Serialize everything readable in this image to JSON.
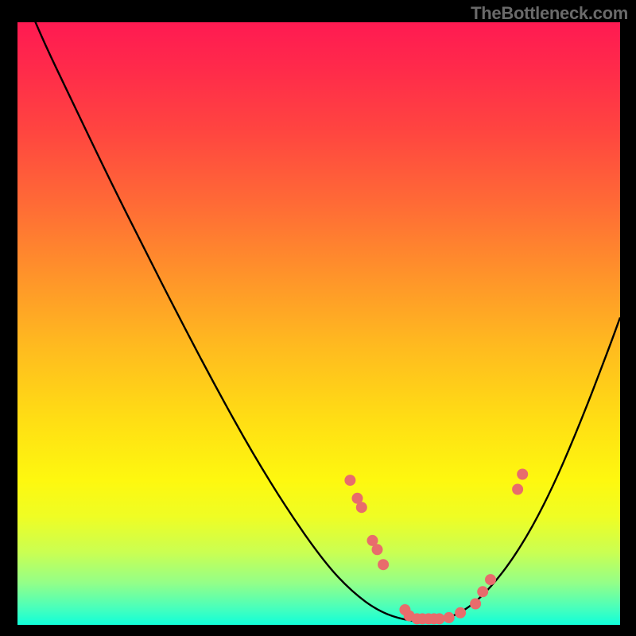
{
  "watermark": "TheBottleneck.com",
  "chart_data": {
    "type": "line",
    "title": "",
    "xlabel": "",
    "ylabel": "",
    "xlim": [
      0,
      1
    ],
    "ylim": [
      0,
      1
    ],
    "curve": [
      {
        "x": 0.005,
        "y": 1.06
      },
      {
        "x": 0.04,
        "y": 0.975
      },
      {
        "x": 0.09,
        "y": 0.87
      },
      {
        "x": 0.15,
        "y": 0.745
      },
      {
        "x": 0.21,
        "y": 0.625
      },
      {
        "x": 0.27,
        "y": 0.507
      },
      {
        "x": 0.33,
        "y": 0.393
      },
      {
        "x": 0.39,
        "y": 0.285
      },
      {
        "x": 0.45,
        "y": 0.188
      },
      {
        "x": 0.51,
        "y": 0.103
      },
      {
        "x": 0.555,
        "y": 0.055
      },
      {
        "x": 0.6,
        "y": 0.022
      },
      {
        "x": 0.645,
        "y": 0.007
      },
      {
        "x": 0.69,
        "y": 0.005
      },
      {
        "x": 0.735,
        "y": 0.018
      },
      {
        "x": 0.78,
        "y": 0.055
      },
      {
        "x": 0.83,
        "y": 0.12
      },
      {
        "x": 0.88,
        "y": 0.21
      },
      {
        "x": 0.93,
        "y": 0.325
      },
      {
        "x": 0.98,
        "y": 0.455
      },
      {
        "x": 1.0,
        "y": 0.51
      }
    ],
    "points": [
      {
        "x": 0.552,
        "y": 0.24
      },
      {
        "x": 0.564,
        "y": 0.21
      },
      {
        "x": 0.571,
        "y": 0.195
      },
      {
        "x": 0.589,
        "y": 0.14
      },
      {
        "x": 0.597,
        "y": 0.125
      },
      {
        "x": 0.607,
        "y": 0.1
      },
      {
        "x": 0.643,
        "y": 0.025
      },
      {
        "x": 0.65,
        "y": 0.015
      },
      {
        "x": 0.663,
        "y": 0.01
      },
      {
        "x": 0.672,
        "y": 0.01
      },
      {
        "x": 0.682,
        "y": 0.01
      },
      {
        "x": 0.691,
        "y": 0.01
      },
      {
        "x": 0.7,
        "y": 0.01
      },
      {
        "x": 0.716,
        "y": 0.012
      },
      {
        "x": 0.735,
        "y": 0.02
      },
      {
        "x": 0.76,
        "y": 0.035
      },
      {
        "x": 0.772,
        "y": 0.055
      },
      {
        "x": 0.785,
        "y": 0.075
      },
      {
        "x": 0.83,
        "y": 0.225
      },
      {
        "x": 0.838,
        "y": 0.25
      }
    ],
    "point_color": "#e86c6c",
    "curve_color": "#000000"
  }
}
